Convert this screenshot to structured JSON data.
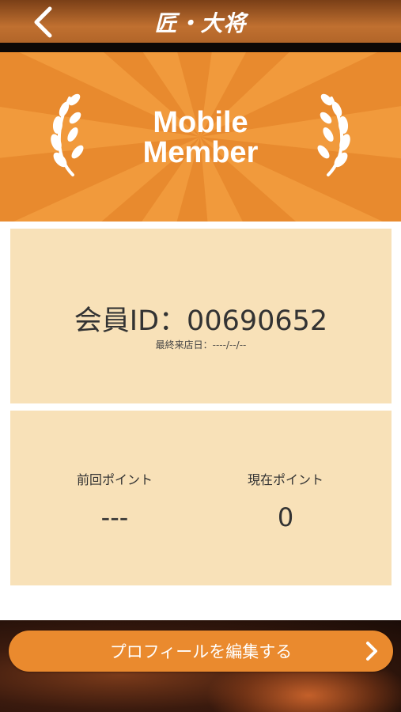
{
  "header": {
    "logo_text": "匠・大将",
    "back_icon": "chevron-left-icon"
  },
  "hero": {
    "title_line1": "Mobile",
    "title_line2": "Member",
    "colors": {
      "background": "#e88a2e",
      "ray": "#f19a3c"
    }
  },
  "member": {
    "id_text": "会員ID：00690652",
    "last_visit_text": "最終来店日：----/--/--"
  },
  "points": {
    "previous_label": "前回ポイント",
    "previous_value": "---",
    "current_label": "現在ポイント",
    "current_value": "0"
  },
  "footer": {
    "edit_profile_label": "プロフィールを編集する",
    "chevron_icon": "chevron-right-icon"
  },
  "colors": {
    "accent": "#ea8a2e",
    "card": "#f8e1b8"
  }
}
